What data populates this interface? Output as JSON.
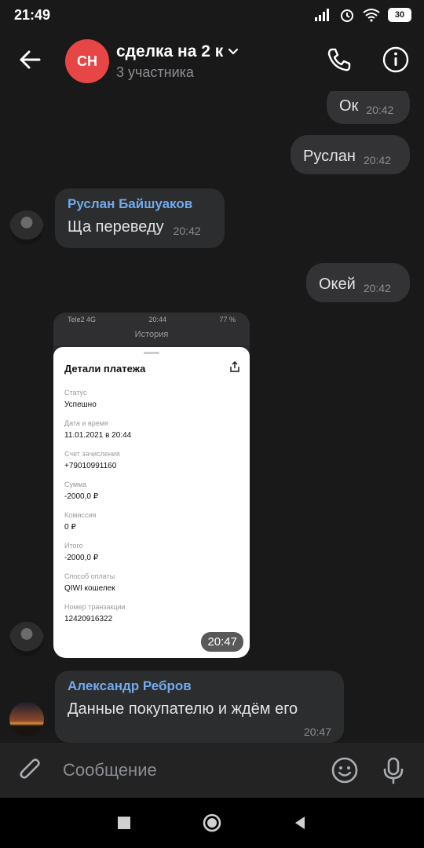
{
  "status_bar": {
    "time": "21:49",
    "battery": "30",
    "icons": [
      "signal-icon",
      "alarm-icon",
      "wifi-icon"
    ]
  },
  "header": {
    "avatar_initials": "СН",
    "avatar_color": "#e64646",
    "title": "сделка на 2 к",
    "subtitle": "3 участника"
  },
  "messages": [
    {
      "type": "outgoing",
      "text": "Ок",
      "time": "20:42"
    },
    {
      "type": "outgoing",
      "text": "Руслан",
      "time": "20:42"
    },
    {
      "type": "incoming",
      "sender": "Руслан Байшуаков",
      "text": "Ща переведу",
      "time": "20:42"
    },
    {
      "type": "outgoing",
      "text": "Окей",
      "time": "20:42"
    },
    {
      "type": "incoming_image",
      "time": "20:47"
    },
    {
      "type": "incoming",
      "sender": "Александр Ребров",
      "text": "Данные покупателю и ждём его",
      "time": "20:47"
    }
  ],
  "screenshot": {
    "carrier": "Tele2 4G",
    "time": "20:44",
    "battery": "77 %",
    "screen_title": "История",
    "card_title": "Детали платежа",
    "fields": [
      {
        "label": "Статус",
        "value": "Успешно"
      },
      {
        "label": "Дата и время",
        "value": "11.01.2021 в 20:44"
      },
      {
        "label": "Счет зачисления",
        "value": "+79010991160"
      },
      {
        "label": "Сумма",
        "value": "-2000,0 ₽"
      },
      {
        "label": "Комиссия",
        "value": "0 ₽"
      },
      {
        "label": "Итого",
        "value": "-2000,0 ₽"
      },
      {
        "label": "Способ оплаты",
        "value": "QIWI кошелек"
      },
      {
        "label": "Номер транзакции",
        "value": "12420916322"
      }
    ]
  },
  "composer": {
    "placeholder": "Сообщение"
  },
  "colors": {
    "background": "#19191a",
    "bubble_out": "#333336",
    "bubble_in": "#2c2d2e",
    "sender_name": "#71aaeb"
  }
}
